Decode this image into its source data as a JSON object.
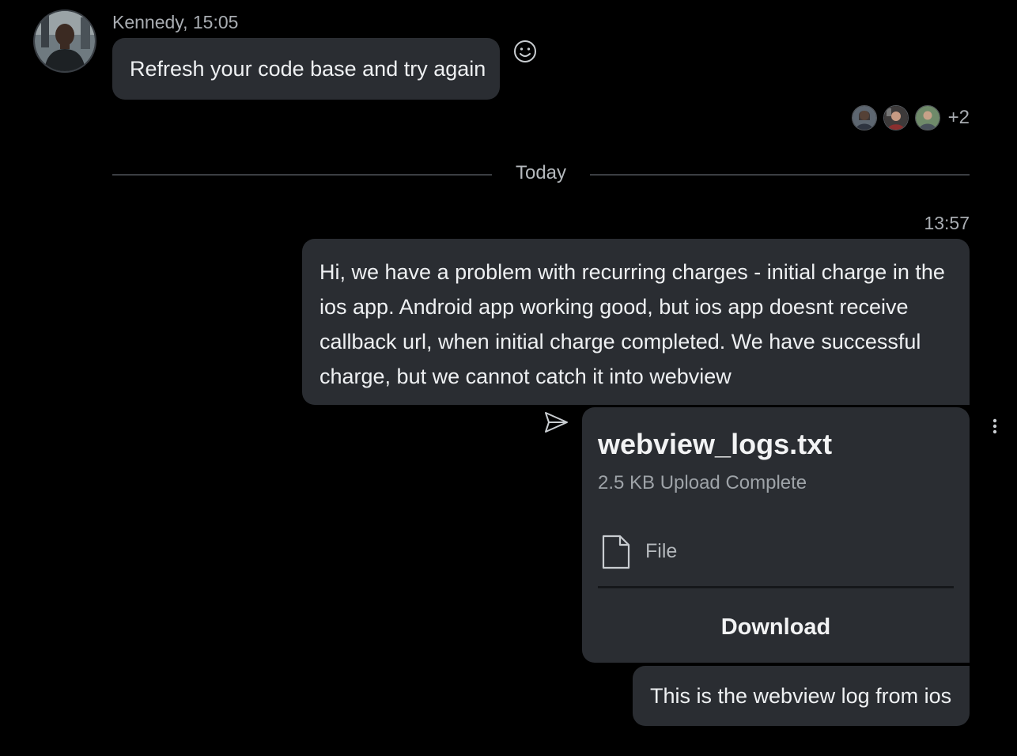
{
  "incoming": {
    "sender_time": "Kennedy, 15:05",
    "text": "Refresh your code base and try again",
    "avatar_icon": "user-avatar-photo",
    "reaction_icon": "smiley-icon"
  },
  "read_receipts": {
    "more_count": "+2"
  },
  "divider": {
    "label": "Today"
  },
  "outgoing": {
    "time": "13:57",
    "text": "Hi, we have a problem with recurring charges - initial charge in the ios app. Android app working good, but ios app doesnt receive callback url, when initial charge completed. We have successful charge, but we cannot catch it into webview",
    "sent_icon": "paper-plane-icon",
    "more_icon": "vertical-ellipsis-icon"
  },
  "attachment": {
    "filename": "webview_logs.txt",
    "meta": "2.5 KB Upload Complete",
    "type_label": "File",
    "type_icon": "document-icon",
    "download_label": "Download"
  },
  "outgoing2": {
    "text": "This is the webview log from ios"
  },
  "colors": {
    "background": "#000000",
    "bubble": "#2a2d32",
    "text": "#eef0f2",
    "muted": "#a9adb2"
  }
}
